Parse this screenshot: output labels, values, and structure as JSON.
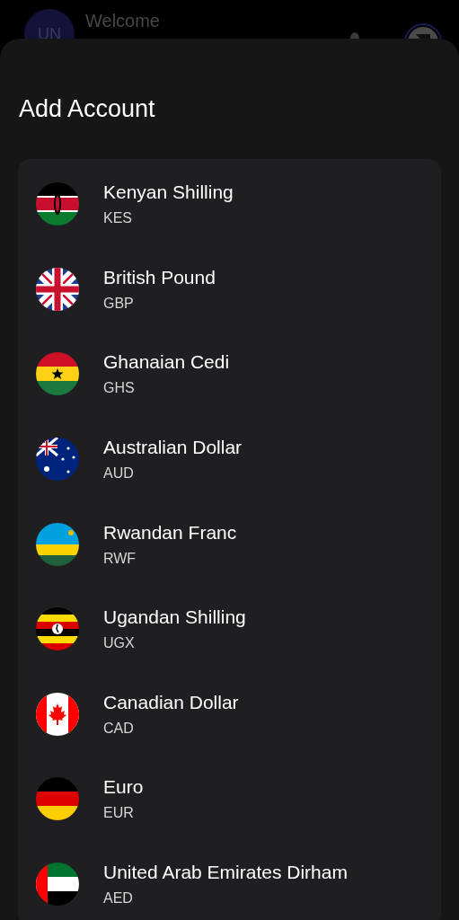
{
  "background": {
    "avatar_initials": "UN",
    "greeting": "Welcome"
  },
  "sheet": {
    "title": "Add Account",
    "accounts": [
      {
        "name": "Kenyan Shilling",
        "code": "KES"
      },
      {
        "name": "British Pound",
        "code": "GBP"
      },
      {
        "name": "Ghanaian Cedi",
        "code": "GHS"
      },
      {
        "name": "Australian Dollar",
        "code": "AUD"
      },
      {
        "name": "Rwandan Franc",
        "code": "RWF"
      },
      {
        "name": "Ugandan Shilling",
        "code": "UGX"
      },
      {
        "name": "Canadian Dollar",
        "code": "CAD"
      },
      {
        "name": "Euro",
        "code": "EUR"
      },
      {
        "name": "United Arab Emirates Dirham",
        "code": "AED"
      }
    ]
  }
}
